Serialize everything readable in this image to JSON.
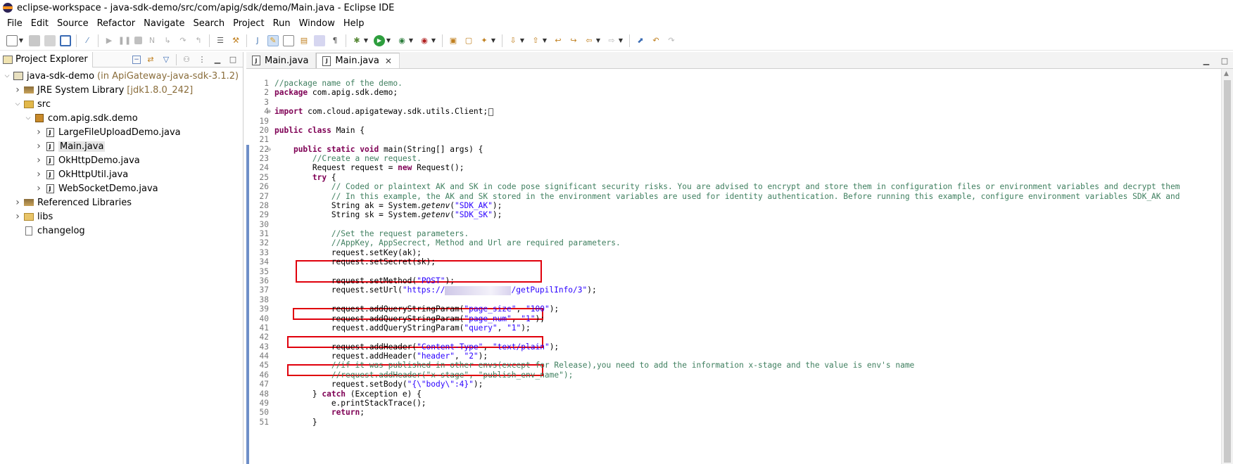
{
  "window": {
    "title": "eclipse-workspace - java-sdk-demo/src/com/apig/sdk/demo/Main.java - Eclipse IDE"
  },
  "menu": [
    "File",
    "Edit",
    "Source",
    "Refactor",
    "Navigate",
    "Search",
    "Project",
    "Run",
    "Window",
    "Help"
  ],
  "project_explorer": {
    "tab_label": "Project Explorer",
    "items": [
      {
        "label": "java-sdk-demo",
        "decoration": "(in ApiGateway-java-sdk-3.1.2)",
        "indent": 0,
        "expanded": true,
        "icon": "project-icon"
      },
      {
        "label": "JRE System Library",
        "decoration": "[jdk1.8.0_242]",
        "indent": 1,
        "expanded": false,
        "icon": "library-icon"
      },
      {
        "label": "src",
        "decoration": "",
        "indent": 1,
        "expanded": true,
        "icon": "source-folder-icon"
      },
      {
        "label": "com.apig.sdk.demo",
        "decoration": "",
        "indent": 2,
        "expanded": true,
        "icon": "package-icon"
      },
      {
        "label": "LargeFileUploadDemo.java",
        "decoration": "",
        "indent": 3,
        "expanded": false,
        "icon": "java-file-icon"
      },
      {
        "label": "Main.java",
        "decoration": "",
        "indent": 3,
        "expanded": false,
        "icon": "java-file-icon",
        "selected": true
      },
      {
        "label": "OkHttpDemo.java",
        "decoration": "",
        "indent": 3,
        "expanded": false,
        "icon": "java-file-icon"
      },
      {
        "label": "OkHttpUtil.java",
        "decoration": "",
        "indent": 3,
        "expanded": false,
        "icon": "java-file-icon"
      },
      {
        "label": "WebSocketDemo.java",
        "decoration": "",
        "indent": 3,
        "expanded": false,
        "icon": "java-file-icon"
      },
      {
        "label": "Referenced Libraries",
        "decoration": "",
        "indent": 1,
        "expanded": false,
        "icon": "library-icon"
      },
      {
        "label": "libs",
        "decoration": "",
        "indent": 1,
        "expanded": false,
        "icon": "folder-icon"
      },
      {
        "label": "changelog",
        "decoration": "",
        "indent": 1,
        "expanded": null,
        "icon": "file-icon"
      }
    ]
  },
  "editor": {
    "tabs": [
      {
        "label": "Main.java",
        "active": false
      },
      {
        "label": "Main.java",
        "active": true
      }
    ],
    "lines": [
      {
        "n": "1",
        "parts": [
          [
            "cm",
            "//package name of the demo."
          ]
        ]
      },
      {
        "n": "2",
        "parts": [
          [
            "kw",
            "package"
          ],
          [
            "",
            " com.apig.sdk.demo;"
          ]
        ]
      },
      {
        "n": "3",
        "parts": []
      },
      {
        "n": "4",
        "fold": "+",
        "parts": [
          [
            "kw",
            "import"
          ],
          [
            "",
            " com.cloud.apigateway.sdk.utils.Client;"
          ],
          [
            "box",
            " "
          ]
        ]
      },
      {
        "n": "19",
        "parts": []
      },
      {
        "n": "20",
        "parts": [
          [
            "kw",
            "public class"
          ],
          [
            "",
            " Main {"
          ]
        ]
      },
      {
        "n": "21",
        "parts": []
      },
      {
        "n": "22",
        "fold": "-",
        "parts": [
          [
            "",
            "    "
          ],
          [
            "kw",
            "public static void"
          ],
          [
            "",
            " main(String[] args) {"
          ]
        ]
      },
      {
        "n": "23",
        "parts": [
          [
            "",
            "        "
          ],
          [
            "cm",
            "//Create a new request."
          ]
        ]
      },
      {
        "n": "24",
        "parts": [
          [
            "",
            "        Request "
          ],
          [
            "",
            "request"
          ],
          [
            "",
            " = "
          ],
          [
            "kw",
            "new"
          ],
          [
            "",
            " Request();"
          ]
        ]
      },
      {
        "n": "25",
        "parts": [
          [
            "",
            "        "
          ],
          [
            "kw",
            "try"
          ],
          [
            "",
            " {"
          ]
        ]
      },
      {
        "n": "26",
        "parts": [
          [
            "",
            "            "
          ],
          [
            "cm",
            "// Coded or plaintext AK and SK in code pose significant security risks. You are advised to encrypt and store them in configuration files or environment variables and decrypt them"
          ]
        ]
      },
      {
        "n": "27",
        "parts": [
          [
            "",
            "            "
          ],
          [
            "cm",
            "// In this example, the AK and SK stored in the environment variables are used for identity authentication. Before running this example, configure environment variables SDK_AK and"
          ]
        ]
      },
      {
        "n": "28",
        "parts": [
          [
            "",
            "            String ak = System."
          ],
          [
            "it",
            "getenv"
          ],
          [
            "",
            "("
          ],
          [
            "str",
            "\"SDK_AK\""
          ],
          [
            "",
            ");"
          ]
        ]
      },
      {
        "n": "29",
        "parts": [
          [
            "",
            "            String sk = System."
          ],
          [
            "it",
            "getenv"
          ],
          [
            "",
            "("
          ],
          [
            "str",
            "\"SDK_SK\""
          ],
          [
            "",
            ");"
          ]
        ]
      },
      {
        "n": "30",
        "parts": []
      },
      {
        "n": "31",
        "parts": [
          [
            "",
            "            "
          ],
          [
            "cm",
            "//Set the request parameters."
          ]
        ]
      },
      {
        "n": "32",
        "parts": [
          [
            "",
            "            "
          ],
          [
            "cm",
            "//AppKey, AppSecrect, Method and Url are required parameters."
          ]
        ]
      },
      {
        "n": "33",
        "parts": [
          [
            "",
            "            request.setKey(ak);"
          ]
        ]
      },
      {
        "n": "34",
        "parts": [
          [
            "",
            "            request.setSecret(sk);"
          ]
        ]
      },
      {
        "n": "35",
        "parts": []
      },
      {
        "n": "36",
        "parts": [
          [
            "",
            "            request.setMethod("
          ],
          [
            "str",
            "\"POST\""
          ],
          [
            "",
            ");"
          ]
        ]
      },
      {
        "n": "37",
        "parts": [
          [
            "",
            "            request.setUrl("
          ],
          [
            "str",
            "\"https://"
          ],
          [
            "blur",
            ""
          ],
          [
            "str",
            "/getPupilInfo/3\""
          ],
          [
            "",
            ");"
          ]
        ]
      },
      {
        "n": "38",
        "parts": []
      },
      {
        "n": "39",
        "parts": [
          [
            "",
            "            request.addQueryStringParam("
          ],
          [
            "str",
            "\"page_size\""
          ],
          [
            "",
            ", "
          ],
          [
            "str",
            "\"100\""
          ],
          [
            "",
            ");"
          ]
        ]
      },
      {
        "n": "40",
        "parts": [
          [
            "",
            "            request.addQueryStringParam("
          ],
          [
            "str",
            "\"page_num\""
          ],
          [
            "",
            ", "
          ],
          [
            "str",
            "\"1\""
          ],
          [
            "",
            ");"
          ]
        ]
      },
      {
        "n": "41",
        "parts": [
          [
            "",
            "            request.addQueryStringParam("
          ],
          [
            "str",
            "\"query\""
          ],
          [
            "",
            ", "
          ],
          [
            "str",
            "\"1\""
          ],
          [
            "",
            ");"
          ]
        ]
      },
      {
        "n": "42",
        "parts": []
      },
      {
        "n": "43",
        "parts": [
          [
            "",
            "            request.addHeader("
          ],
          [
            "str",
            "\"Content-Type\""
          ],
          [
            "",
            ", "
          ],
          [
            "str",
            "\"text/plain\""
          ],
          [
            "",
            ");"
          ]
        ]
      },
      {
        "n": "44",
        "parts": [
          [
            "",
            "            request.addHeader("
          ],
          [
            "str",
            "\"header\""
          ],
          [
            "",
            ", "
          ],
          [
            "str",
            "\"2\""
          ],
          [
            "",
            ");"
          ]
        ]
      },
      {
        "n": "45",
        "parts": [
          [
            "",
            "            "
          ],
          [
            "cm",
            "//if it was published in other envs(except for Release),you need to add the information x-stage and the value is env's name"
          ]
        ]
      },
      {
        "n": "46",
        "parts": [
          [
            "",
            "            "
          ],
          [
            "cm",
            "//request.addHeader(\"x-stage\", \"publish_env_name\");"
          ]
        ]
      },
      {
        "n": "47",
        "parts": [
          [
            "",
            "            request.setBody("
          ],
          [
            "str",
            "\"{\\\"body\\\":4}\""
          ],
          [
            "",
            ");"
          ]
        ]
      },
      {
        "n": "48",
        "parts": [
          [
            "",
            "        } "
          ],
          [
            "kw",
            "catch"
          ],
          [
            "",
            " (Exception e) {"
          ]
        ]
      },
      {
        "n": "49",
        "parts": [
          [
            "",
            "            e.printStackTrace();"
          ]
        ]
      },
      {
        "n": "50",
        "parts": [
          [
            "",
            "            "
          ],
          [
            "kw",
            "return"
          ],
          [
            "",
            ";"
          ]
        ]
      },
      {
        "n": "51",
        "parts": [
          [
            "",
            "        }"
          ]
        ]
      }
    ]
  },
  "colors": {
    "keyword": "#7f0055",
    "comment": "#3f7f5f",
    "string": "#2a00ff",
    "highlight_box": "#e0000c",
    "change_bar": "#6f8fc8"
  }
}
